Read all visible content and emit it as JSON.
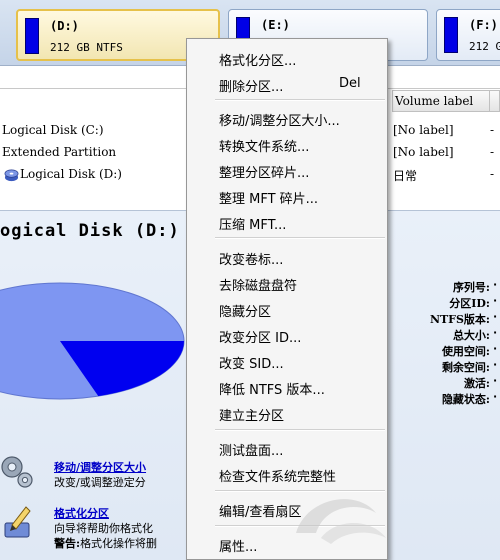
{
  "disk_bar": {
    "disks": [
      {
        "name": "(D:)",
        "info": "212 GB NTFS",
        "selected": true
      },
      {
        "name": "(E:)",
        "info": "",
        "selected": false
      },
      {
        "name": "(F:)",
        "info": "212 G",
        "selected": false
      }
    ]
  },
  "partition_list": {
    "column_header": "Volume label",
    "rows": [
      {
        "name": "Logical Disk (C:)",
        "label": "[No label]",
        "dash": "-"
      },
      {
        "name": "Extended Partition",
        "label": "[No label]",
        "dash": "-"
      },
      {
        "name": "Logical Disk (D:)",
        "label": "日常",
        "dash": "-"
      }
    ]
  },
  "detail": {
    "title": "ogical Disk (D:)",
    "pie_used_fraction": 0.2,
    "colors": {
      "free": "#7e96f2",
      "used": "#0000f0"
    },
    "properties": [
      "序列号:",
      "分区ID:",
      "NTFS版本:",
      "总大小:",
      "使用空间:",
      "剩余空间:",
      "激活:",
      "隐藏状态:"
    ],
    "tools": [
      {
        "title": "移动/调整分区大小",
        "desc": "改变/或调整逊定分"
      },
      {
        "title": "格式化分区",
        "desc": "向导将帮助你格式化",
        "warn_prefix": "警告:",
        "warn_text": "格式化操作将删"
      }
    ]
  },
  "context_menu": {
    "items": [
      {
        "label": "格式化分区...",
        "shortcut": ""
      },
      {
        "label": "删除分区...",
        "shortcut": "Del"
      },
      {
        "label": "移动/调整分区大小...",
        "shortcut": ""
      },
      {
        "label": "转换文件系统...",
        "shortcut": ""
      },
      {
        "label": "整理分区碎片...",
        "shortcut": ""
      },
      {
        "label": "整理 MFT 碎片...",
        "shortcut": ""
      },
      {
        "label": "压缩 MFT...",
        "shortcut": ""
      },
      {
        "label": "改变卷标...",
        "shortcut": ""
      },
      {
        "label": "去除磁盘盘符",
        "shortcut": ""
      },
      {
        "label": "隐藏分区",
        "shortcut": ""
      },
      {
        "label": "改变分区 ID...",
        "shortcut": ""
      },
      {
        "label": "改变 SID...",
        "shortcut": ""
      },
      {
        "label": "降低 NTFS 版本...",
        "shortcut": ""
      },
      {
        "label": "建立主分区",
        "shortcut": ""
      },
      {
        "label": "测试盘面...",
        "shortcut": ""
      },
      {
        "label": "检查文件系统完整性",
        "shortcut": ""
      },
      {
        "label": "编辑/查看扇区",
        "shortcut": ""
      },
      {
        "label": "属性...",
        "shortcut": ""
      }
    ]
  }
}
